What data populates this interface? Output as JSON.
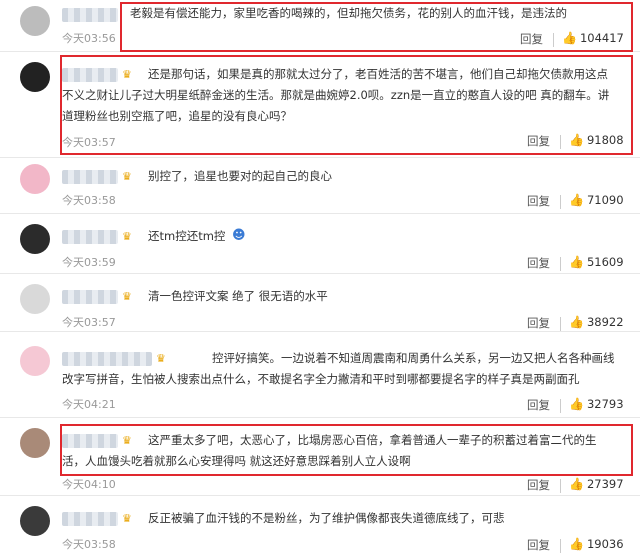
{
  "comments": [
    {
      "text_lines": [
        "老毅是有偿还能力，家里吃香的喝辣的，但却拖欠债务，花的别人的血汗钱，是违法的"
      ],
      "time": "今天03:56",
      "reply": "回复",
      "likes": "104417",
      "highlighted": true
    },
    {
      "text_lines": [
        "还是那句话，如果是真的那就太过分了，老百姓活的苦不堪言，他们自己却拖欠债款用这点",
        "不义之财让儿子过大明星纸醉金迷的生活。那就是曲婉婷2.0呗。zzn是一直立的憨直人设的吧 真的翻车。讲",
        "道理粉丝也别空瓶了吧，追星的没有良心吗？"
      ],
      "time": "今天03:57",
      "reply": "回复",
      "likes": "91808",
      "highlighted": true
    },
    {
      "text_lines": [
        "别控了，追星也要对的起自己的良心"
      ],
      "time": "今天03:58",
      "reply": "回复",
      "likes": "71090",
      "highlighted": false
    },
    {
      "text_lines": [
        "还tm控还tm控"
      ],
      "time": "今天03:59",
      "reply": "回复",
      "likes": "51609",
      "highlighted": false
    },
    {
      "text_lines": [
        "清一色控评文案 绝了 很无语的水平"
      ],
      "time": "今天03:57",
      "reply": "回复",
      "likes": "38922",
      "highlighted": false
    },
    {
      "text_lines": [
        "控评好搞笑。一边说着不知道周震南和周勇什么关系，另一边又把人名各种画线",
        "改字写拼音，生怕被人搜索出点什么，不敢提名字全力撇清和平时到哪都要提名字的样子真是两副面孔"
      ],
      "time": "今天04:21",
      "reply": "回复",
      "likes": "32793",
      "highlighted": false
    },
    {
      "text_lines": [
        "这严重太多了吧，太恶心了，比塌房恶心百倍，拿着普通人一辈子的积蓄过着富二代的生",
        "活，人血馒头吃着就那么心安理得吗 就这还好意思踩着别人立人设啊"
      ],
      "time": "今天04:10",
      "reply": "回复",
      "likes": "27397",
      "highlighted": true
    },
    {
      "text_lines": [
        "反正被骗了血汗钱的不是粉丝，为了维护偶像都丧失道德底线了，可悲"
      ],
      "time": "今天03:58",
      "reply": "回复",
      "likes": "19036",
      "highlighted": false
    }
  ],
  "icons": {
    "like": "thumbs-up-icon",
    "crown": "crown-badge-icon"
  },
  "colors": {
    "highlight_border": "#e0282e",
    "time_text": "#999999"
  }
}
